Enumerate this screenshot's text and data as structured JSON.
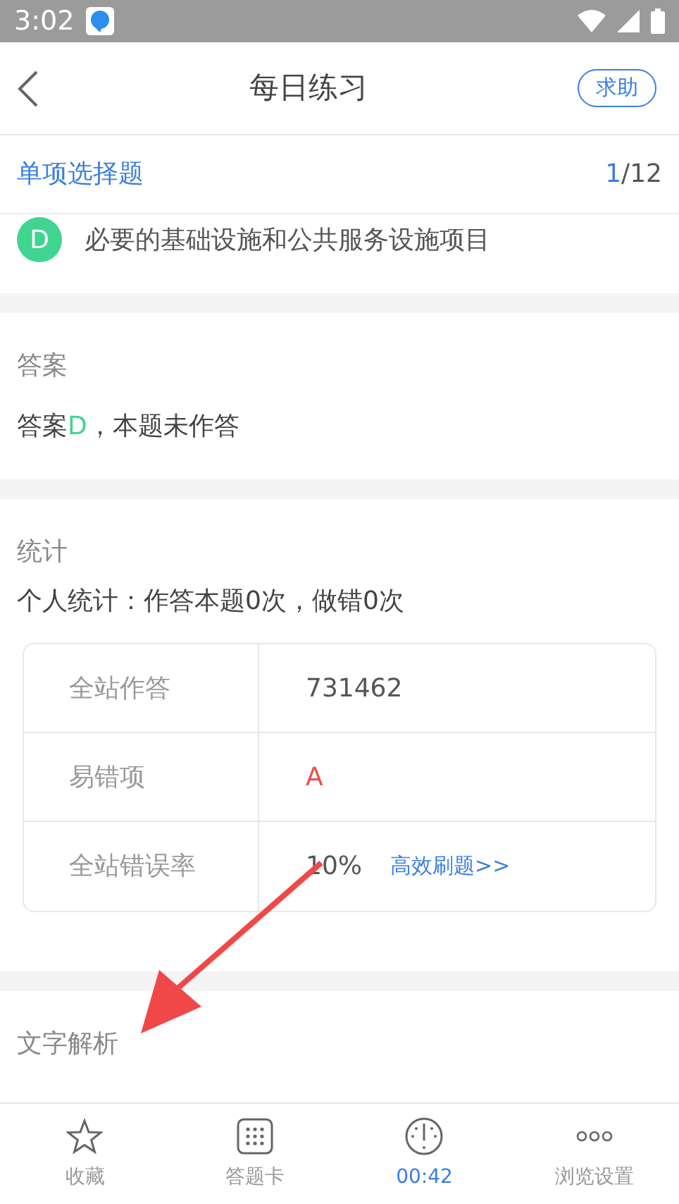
{
  "status_bar": {
    "time": "3:02"
  },
  "header": {
    "title": "每日练习",
    "help_button": "求助"
  },
  "question_bar": {
    "type": "单项选择题",
    "current": "1",
    "total": "/12"
  },
  "option": {
    "letter": "D",
    "text": "必要的基础设施和公共服务设施项目",
    "color": "#3fd490"
  },
  "answer": {
    "heading": "答案",
    "prefix": "答案",
    "letter": "D",
    "suffix": "，本题未作答"
  },
  "stats": {
    "heading": "统计",
    "personal": "个人统计：作答本题0次，做错0次",
    "rows": [
      {
        "label": "全站作答",
        "value": "731462",
        "kind": "plain"
      },
      {
        "label": "易错项",
        "value": "A",
        "kind": "error"
      },
      {
        "label": "全站错误率",
        "value": "10%",
        "kind": "plain",
        "link": "高效刷题>>"
      }
    ]
  },
  "analysis": {
    "heading": "文字解析"
  },
  "tab_bar": [
    {
      "label": "收藏",
      "kind": "star",
      "selected": false
    },
    {
      "label": "答题卡",
      "kind": "grid",
      "selected": false
    },
    {
      "label": "00:42",
      "kind": "timer",
      "selected": true
    },
    {
      "label": "浏览设置",
      "kind": "more",
      "selected": false
    }
  ]
}
